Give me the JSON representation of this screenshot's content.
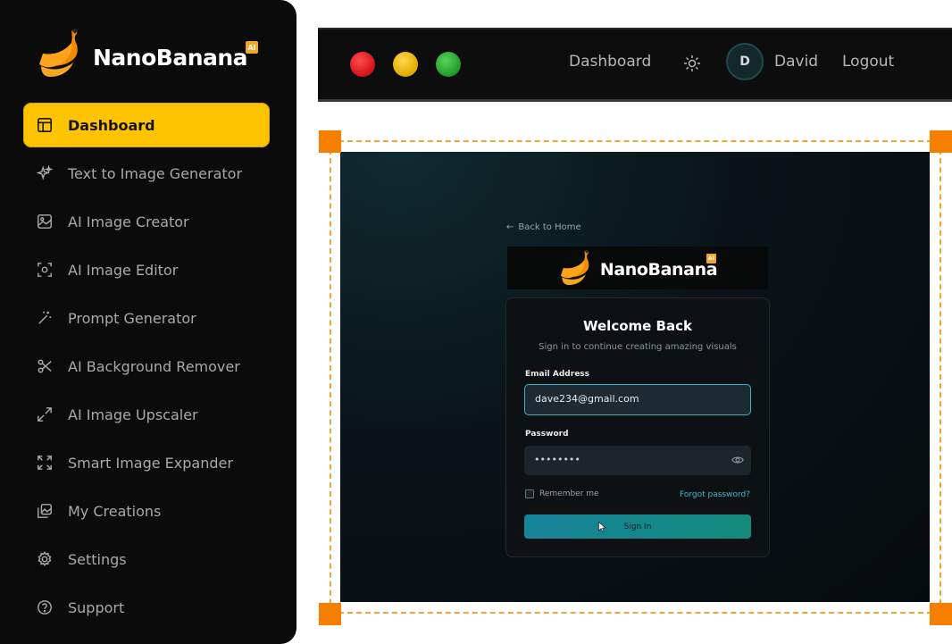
{
  "brand": {
    "name": "NanoBanana",
    "badge": "AI"
  },
  "sidebar": {
    "items": [
      {
        "label": "Dashboard",
        "icon": "layout-icon",
        "active": true
      },
      {
        "label": "Text to Image Generator",
        "icon": "sparkles-icon"
      },
      {
        "label": "AI Image Creator",
        "icon": "image-icon"
      },
      {
        "label": "AI Image Editor",
        "icon": "scan-icon"
      },
      {
        "label": "Prompt Generator",
        "icon": "magic-wand-icon"
      },
      {
        "label": "AI Background Remover",
        "icon": "scissors-icon"
      },
      {
        "label": "AI Image Upscaler",
        "icon": "expand-arrows-icon"
      },
      {
        "label": "Smart Image Expander",
        "icon": "fullscreen-icon"
      },
      {
        "label": "My Creations",
        "icon": "gallery-icon"
      },
      {
        "label": "Settings",
        "icon": "gear-icon"
      },
      {
        "label": "Support",
        "icon": "help-circle-icon"
      }
    ]
  },
  "topbar": {
    "dashboard": "Dashboard",
    "theme_icon": "sun-icon",
    "avatar_initial": "D",
    "user_name": "David",
    "logout": "Logout"
  },
  "login": {
    "back_link": "Back to Home",
    "brand_name": "NanoBanana",
    "brand_badge": "AI",
    "title": "Welcome Back",
    "subtitle": "Sign in to continue creating amazing visuals",
    "email_label": "Email Address",
    "email_value": "dave234@gmail.com",
    "password_label": "Password",
    "password_value": "••••••••",
    "remember_label": "Remember me",
    "forgot_label": "Forgot password?",
    "signin_label": "Sign In"
  },
  "colors": {
    "accent": "#ffc400",
    "handle": "#f77f00",
    "teal": "#38b3c6",
    "window_red": "#d3121b",
    "window_yellow": "#e2a900",
    "window_green": "#1e9a2b"
  }
}
